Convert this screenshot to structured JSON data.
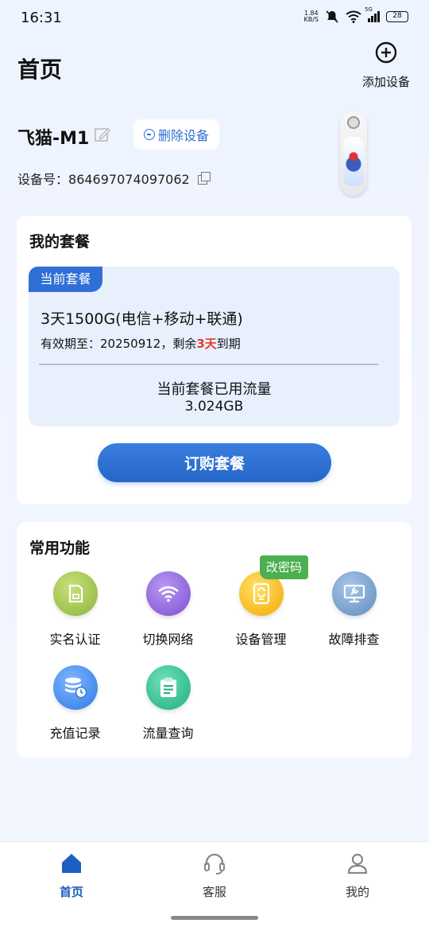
{
  "status_bar": {
    "time": "16:31",
    "net_speed_value": "1.84",
    "net_speed_unit": "KB/S",
    "network_type": "5G",
    "battery": "28",
    "icons": [
      "mute-icon",
      "wifi-icon",
      "signal-icon",
      "battery-icon"
    ]
  },
  "header": {
    "title": "首页",
    "add_device_label": "添加设备"
  },
  "device": {
    "name": "飞猫-M1",
    "delete_label": "删除设备",
    "serial_label": "设备号：",
    "serial_value": "864697074097062"
  },
  "plan": {
    "title": "我的套餐",
    "tag": "当前套餐",
    "name": "3天1500G(电信+移动+联通)",
    "expiry_prefix": "有效期至：20250912，剩余",
    "remaining": "3天",
    "expiry_suffix": "到期",
    "usage_label": "当前套餐已用流量",
    "usage_value": "3.024GB",
    "order_button": "订购套餐"
  },
  "functions": {
    "title": "常用功能",
    "badge": "改密码",
    "items": [
      {
        "label": "实名认证",
        "icon": "sd-card-icon",
        "color": "#8bb53c"
      },
      {
        "label": "切换网络",
        "icon": "wifi-icon",
        "color": "#7a4fd4"
      },
      {
        "label": "设备管理",
        "icon": "device-icon",
        "color": "#f5a800"
      },
      {
        "label": "故障排查",
        "icon": "monitor-wrench-icon",
        "color": "#5d8cc0"
      },
      {
        "label": "充值记录",
        "icon": "database-clock-icon",
        "color": "#2e78e6"
      },
      {
        "label": "流量查询",
        "icon": "clipboard-icon",
        "color": "#1fae83"
      }
    ]
  },
  "nav": {
    "active_color": "#1f5fc2",
    "items": [
      {
        "label": "首页",
        "icon": "home-icon"
      },
      {
        "label": "客服",
        "icon": "headset-icon"
      },
      {
        "label": "我的",
        "icon": "user-icon"
      }
    ]
  }
}
